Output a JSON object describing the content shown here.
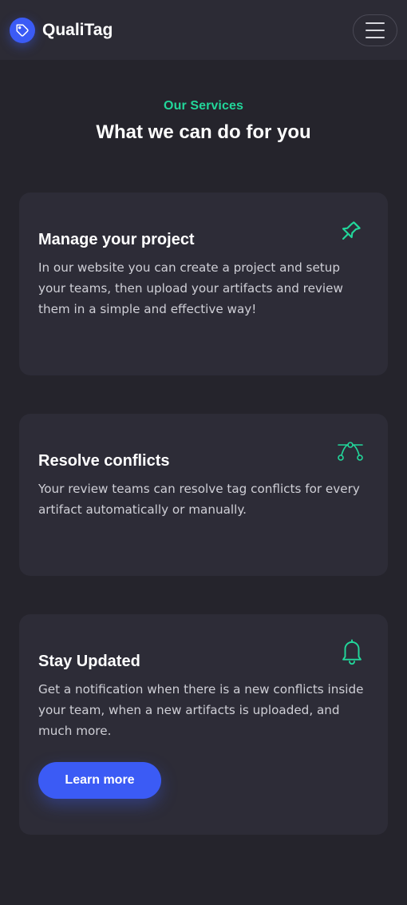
{
  "brand": {
    "name": "QualiTag",
    "logo_icon": "tag-icon"
  },
  "nav": {
    "menu_icon": "hamburger-menu-icon"
  },
  "section": {
    "eyebrow": "Our Services",
    "title": "What we can do for you"
  },
  "cards": [
    {
      "title": "Manage your project",
      "text": "In our website you can create a project and setup your teams, then upload your artifacts and review them in a simple and effective way!",
      "icon": "pin-icon"
    },
    {
      "title": "Resolve conflicts",
      "text": "Your review teams can resolve tag conflicts for every artifact automatically or manually.",
      "icon": "bezier-curve-icon"
    },
    {
      "title": "Stay Updated",
      "text": "Get a notification when there is a new conflicts inside your team, when a new artifacts is uploaded, and much more.",
      "icon": "bell-icon",
      "button_label": "Learn more"
    }
  ],
  "colors": {
    "background": "#25242c",
    "navbar": "#2c2b35",
    "card": "#2d2c37",
    "accent_green": "#22d69a",
    "accent_blue": "#3b5bf5"
  }
}
